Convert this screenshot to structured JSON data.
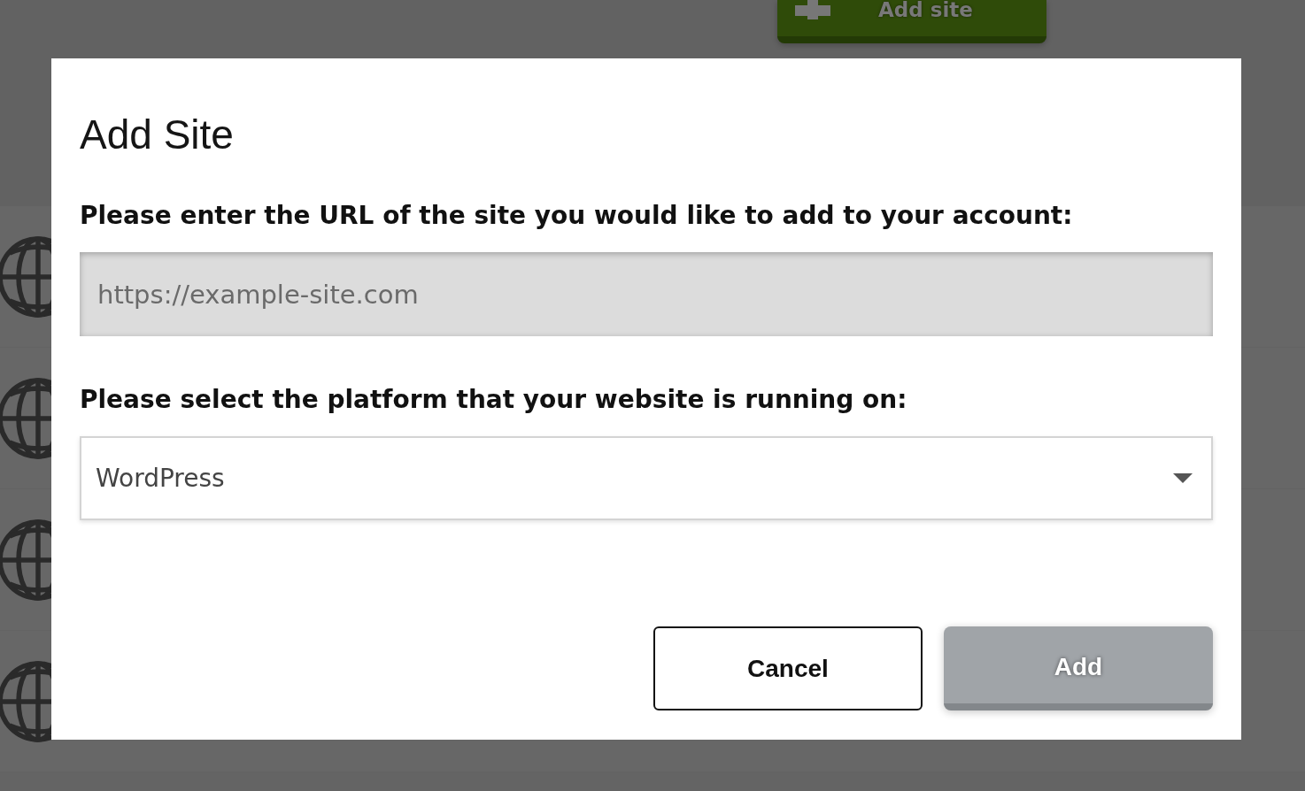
{
  "background": {
    "add_site_button": {
      "label": "Add site"
    }
  },
  "dialog": {
    "title": "Add Site",
    "fields": [
      {
        "kind": "text",
        "label": "Please enter the URL of the site you would like to add to your account:",
        "placeholder": "https://example-site.com"
      },
      {
        "kind": "select",
        "label": "Please select the platform that your website is running on:",
        "value": "WordPress"
      }
    ],
    "buttons": [
      {
        "kind": "secondary",
        "label": "Cancel",
        "disabled": false
      },
      {
        "kind": "primary",
        "label": "Add",
        "disabled": true
      }
    ]
  }
}
